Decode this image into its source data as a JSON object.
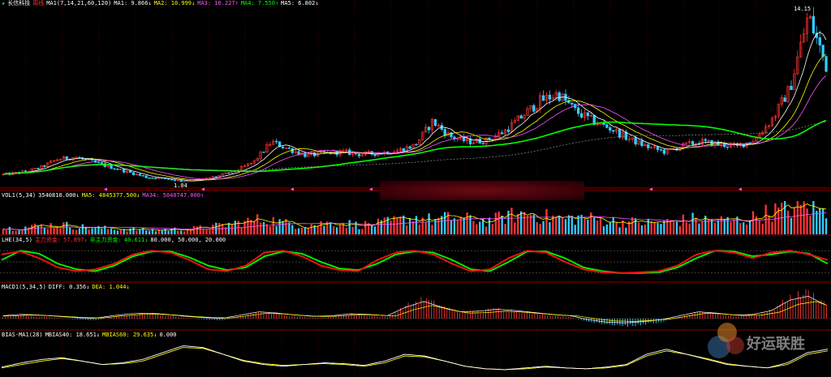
{
  "panels": {
    "price": {
      "star": "★",
      "name": "长信科技",
      "period": "周线",
      "params": "MA1(7,14,21,60,120)",
      "ma1": "MA1: 9.866↓",
      "ma2": "MA2: 10.999↓",
      "ma3": "MA3: 10.227↑",
      "ma4": "MA4: 7.550↑",
      "ma5": "MA5: 6.802↓",
      "high_label": "14.15",
      "low_label": "1.04"
    },
    "vol": {
      "params": "VOL1(5,34)",
      "value": "3540810.000↓",
      "ma5": "MA5: 4845377.500↓",
      "ma34": "MA34: 5040747.000↑"
    },
    "zhulizijin": {
      "params": "LHE(34,5)",
      "main_label": "主力资金:",
      "main_value": "57.897↓",
      "nonmain_label": "非主力资金:",
      "nonmain_value": "40.611↓",
      "levels": "80.000, 50.000, 20.000"
    },
    "macd": {
      "params": "MACD1(5,34,5)",
      "diff": "DIFF: 0.356↓",
      "dea": "DEA: 1.044↓"
    },
    "bias": {
      "params": "BIAS-MA1(28)",
      "mbias40": "MBIAS40: 18.651↓",
      "mbias60": "MBIAS60: 29.635↓",
      "zero": "0.000"
    }
  },
  "watermark": "好运联胜",
  "colors": {
    "background": "#000000",
    "up": "#ff3333",
    "down": "#33ccff",
    "ma1": "#ffffff",
    "ma2": "#ffff00",
    "ma3": "#ff55ff",
    "ma4": "#00ff00",
    "ma5": "#999999",
    "grid": "#5a0000"
  },
  "chart_data": {
    "type": "candlestick",
    "price_trend": [
      1.6,
      1.8,
      2.1,
      2.8,
      3.0,
      2.6,
      2.2,
      1.8,
      1.4,
      1.3,
      1.1,
      1.2,
      1.5,
      1.9,
      2.6,
      4.2,
      3.6,
      3.1,
      3.3,
      3.4,
      3.2,
      3.3,
      3.5,
      3.9,
      5.8,
      4.6,
      4.2,
      4.3,
      5.0,
      6.2,
      7.4,
      8.0,
      6.6,
      5.8,
      5.2,
      4.4,
      3.8,
      3.4,
      3.9,
      4.2,
      4.0,
      3.8,
      4.4,
      6.0,
      8.5,
      14.15,
      10.2
    ],
    "volume_trend": [
      0.8,
      1.0,
      1.2,
      1.4,
      1.1,
      0.9,
      0.8,
      0.7,
      0.6,
      0.7,
      0.8,
      1.0,
      1.4,
      1.8,
      2.2,
      1.6,
      1.3,
      1.5,
      1.7,
      1.3,
      1.5,
      1.9,
      2.4,
      2.0,
      2.4,
      2.1,
      1.9,
      2.6,
      3.0,
      2.5,
      2.2,
      2.4,
      2.0,
      1.8,
      1.7,
      1.6,
      1.9,
      2.2,
      2.0,
      1.9,
      2.3,
      3.2,
      3.6,
      4.0,
      3.0
    ],
    "zhuli_main_trend": [
      70,
      78,
      60,
      35,
      25,
      30,
      45,
      70,
      80,
      75,
      55,
      30,
      25,
      40,
      75,
      80,
      65,
      40,
      28,
      25,
      55,
      75,
      80,
      70,
      45,
      25,
      30,
      60,
      80,
      75,
      50,
      30,
      22,
      20,
      22,
      25,
      40,
      70,
      80,
      75,
      60,
      75,
      80,
      70,
      55
    ],
    "zhuli_nonmain_trend": [
      55,
      80,
      72,
      45,
      30,
      25,
      40,
      65,
      78,
      78,
      62,
      40,
      28,
      35,
      65,
      78,
      72,
      50,
      32,
      28,
      45,
      70,
      78,
      75,
      55,
      30,
      25,
      50,
      78,
      78,
      60,
      35,
      25,
      20,
      20,
      22,
      35,
      60,
      80,
      78,
      65,
      70,
      78,
      72,
      45
    ],
    "macd_histogram_trend": [
      0.2,
      0.4,
      0.3,
      0.1,
      -0.1,
      -0.2,
      0.2,
      0.5,
      0.6,
      0.4,
      0.1,
      -0.1,
      -0.2,
      0.3,
      0.8,
      0.6,
      0.3,
      0.1,
      0.2,
      0.5,
      0.4,
      0.2,
      1.5,
      2.4,
      1.5,
      0.8,
      0.9,
      1.2,
      1.0,
      0.7,
      0.4,
      0.2,
      -0.4,
      -0.8,
      -0.9,
      -0.7,
      -0.4,
      0.2,
      0.8,
      0.6,
      0.3,
      0.4,
      1.0,
      2.6,
      3.2,
      1.8
    ],
    "bias_mbias40_trend": [
      5,
      10,
      14,
      16,
      12,
      8,
      10,
      14,
      22,
      30,
      28,
      20,
      12,
      8,
      6,
      8,
      10,
      9,
      7,
      12,
      20,
      18,
      12,
      6,
      3,
      2,
      4,
      6,
      4,
      3,
      5,
      8,
      20,
      26,
      20,
      14,
      8,
      6,
      4,
      10,
      22,
      26
    ],
    "bias_mbias60_trend": [
      4,
      8,
      12,
      15,
      12,
      8,
      9,
      12,
      20,
      28,
      27,
      20,
      13,
      9,
      7,
      8,
      9,
      8,
      6,
      10,
      18,
      17,
      12,
      6,
      3,
      2,
      3,
      5,
      4,
      3,
      4,
      7,
      18,
      24,
      20,
      15,
      9,
      6,
      4,
      8,
      20,
      24
    ]
  }
}
